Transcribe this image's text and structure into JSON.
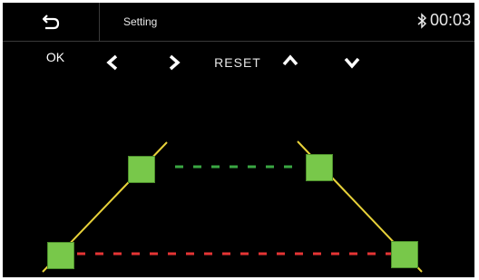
{
  "header": {
    "title": "Setting",
    "time": "00:03",
    "back_icon": "back-arrow-icon",
    "status_icon": "bluetooth-icon"
  },
  "toolbar": {
    "ok_label": "OK",
    "reset_label": "RESET",
    "icons": [
      "chevron-left-icon",
      "chevron-right-icon",
      "chevron-up-icon",
      "chevron-down-icon"
    ]
  },
  "colors": {
    "background": "#000000",
    "handle": "#78c84a",
    "side_line": "#e8d23a",
    "near_line": "#e53535",
    "far_line": "#3aa843"
  }
}
